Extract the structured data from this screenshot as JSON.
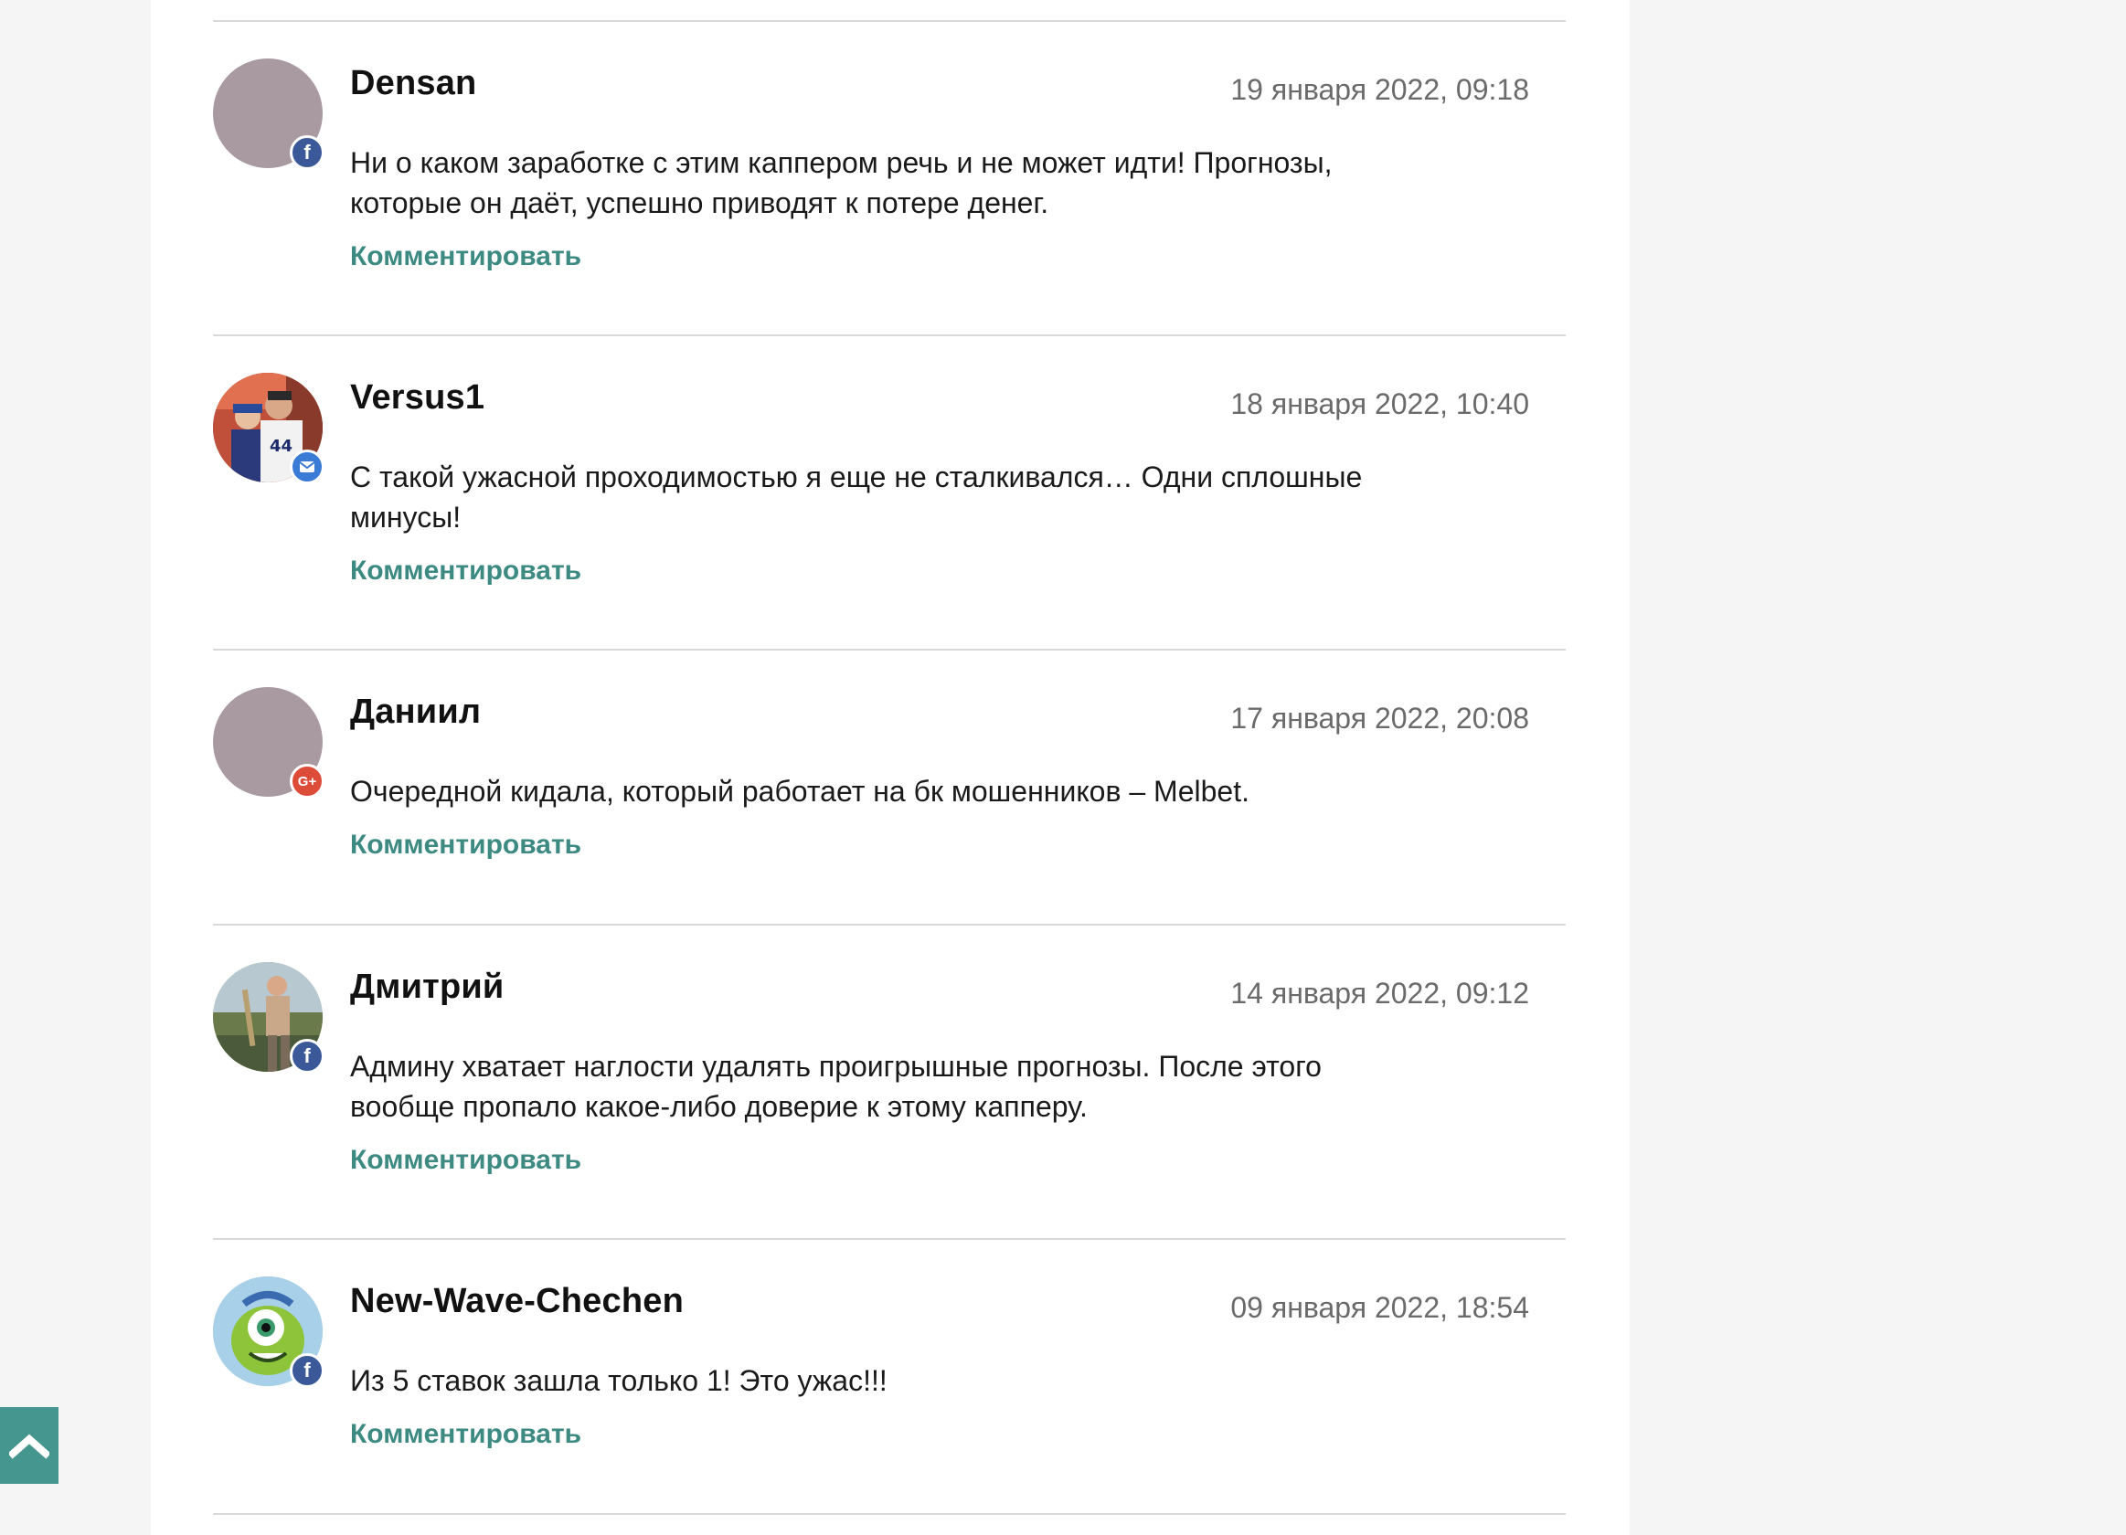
{
  "reply_label": "Комментировать",
  "colors": {
    "accent": "#3d8a83",
    "scroll_button": "#45968e",
    "facebook": "#3b5998",
    "email": "#3a7bd5",
    "google": "#dd4b39"
  },
  "comments": [
    {
      "author": "Densan",
      "date": "19 января 2022, 09:18",
      "text_lines": [
        "Ни о каком заработке с этим каппером речь и не может идти! Прогнозы,",
        "которые он даёт, успешно приводят к потере денег."
      ],
      "avatar": "placeholder",
      "badge": "facebook-icon"
    },
    {
      "author": "Versus1",
      "date": "18 января 2022, 10:40",
      "text_lines": [
        "С такой ужасной проходимостью я еще не сталкивался… Одни сплошные",
        "минусы!"
      ],
      "avatar": "photo",
      "badge": "email-icon"
    },
    {
      "author": "Даниил",
      "date": "17 января 2022, 20:08",
      "text_lines": [
        "Очередной кидала, который работает на бк мошенников – Melbet."
      ],
      "avatar": "placeholder",
      "badge": "google-plus-icon"
    },
    {
      "author": "Дмитрий",
      "date": "14 января 2022, 09:12",
      "text_lines": [
        "Админу хватает наглости удалять проигрышные прогнозы. После этого",
        "вообще пропало какое-либо доверие к этому капперу."
      ],
      "avatar": "photo",
      "badge": "facebook-icon"
    },
    {
      "author": "New-Wave-Chechen",
      "date": "09 января 2022, 18:54",
      "text_lines": [
        "Из 5 ставок зашла только 1! Это ужас!!!"
      ],
      "avatar": "cartoon",
      "badge": "facebook-icon"
    }
  ],
  "badges": {
    "facebook": "f",
    "google": "G+"
  }
}
